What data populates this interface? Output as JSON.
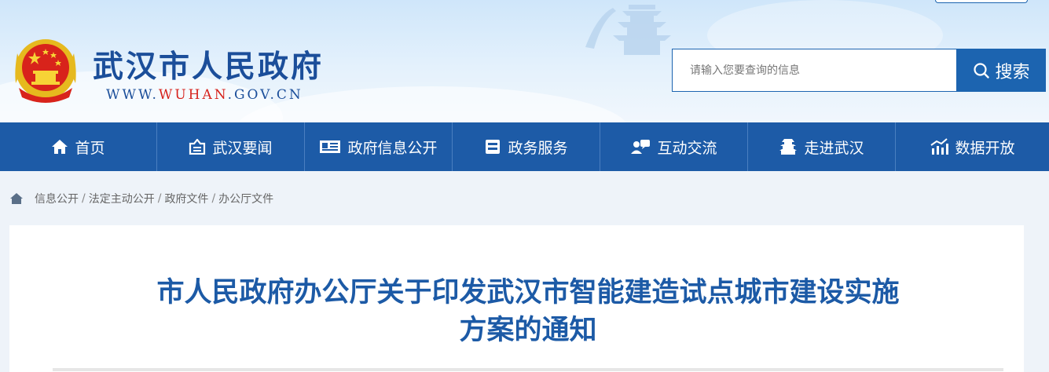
{
  "header": {
    "site_name": "武汉市人民政府",
    "url_prefix": "WWW.",
    "url_highlight": "WUHAN",
    "url_suffix": ".GOV.CN",
    "emblem_icon": "national-emblem-icon"
  },
  "search": {
    "placeholder": "请输入您要查询的信息",
    "value": "",
    "button_label": "搜索",
    "icon": "search-icon"
  },
  "nav": {
    "items": [
      {
        "label": "首页",
        "icon": "home-icon"
      },
      {
        "label": "武汉要闻",
        "icon": "news-icon"
      },
      {
        "label": "政府信息公开",
        "icon": "info-disclosure-icon"
      },
      {
        "label": "政务服务",
        "icon": "service-icon"
      },
      {
        "label": "互动交流",
        "icon": "interaction-icon"
      },
      {
        "label": "走进武汉",
        "icon": "tower-icon"
      },
      {
        "label": "数据开放",
        "icon": "chart-icon"
      }
    ]
  },
  "breadcrumb": {
    "icon": "home-icon",
    "items": [
      "信息公开",
      "法定主动公开",
      "政府文件",
      "办公厅文件"
    ],
    "separator": "/"
  },
  "article": {
    "title_line1": "市人民政府办公厅关于印发武汉市智能建造试点城市建设实施",
    "title_line2": "方案的通知"
  },
  "colors": {
    "brand_blue": "#1d5ba7",
    "title_blue": "#1c5aa6",
    "url_red": "#d6221c"
  }
}
